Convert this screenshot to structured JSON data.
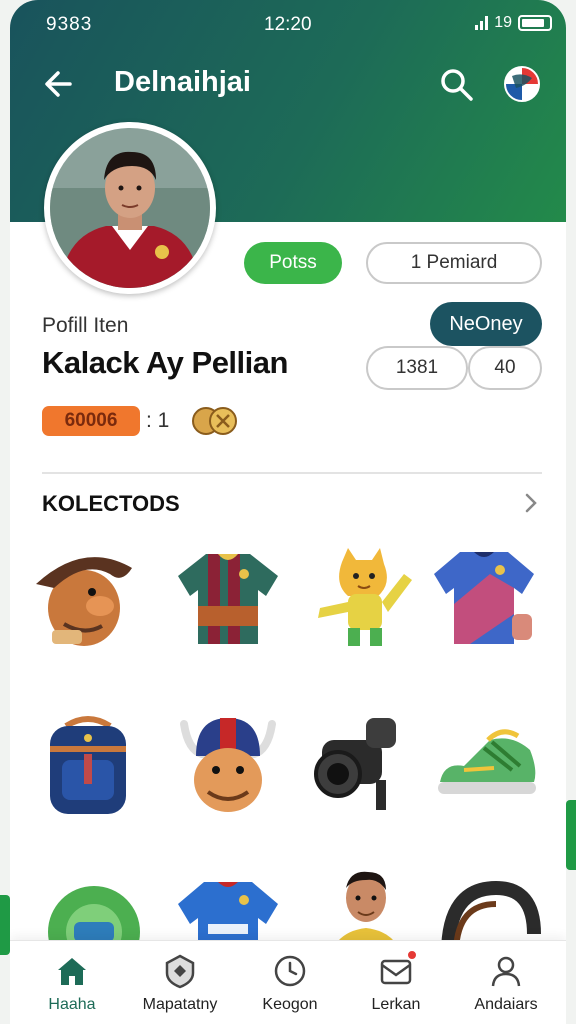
{
  "status_bar": {
    "left": "9383",
    "time": "12:20",
    "right": "19"
  },
  "header": {
    "title": "Delnaihjai",
    "back_icon": "arrow-left-icon",
    "search_icon": "search-icon",
    "globe_icon": "globe-icon"
  },
  "profile": {
    "subtitle": "Pofill Iten",
    "name": "Kalack Ay Pellian",
    "posts_label": "Potss",
    "premiard_label": "1 Pemiard",
    "money_label": "NeOney",
    "stat_a": "1381",
    "stat_b": "40",
    "level_badge": "60006",
    "level_suffix": ": 1"
  },
  "collections": {
    "title": "KOLECTODS",
    "items": [
      "pirate-hat-icon",
      "jersey-red-icon",
      "mascot-cat-icon",
      "jersey-blue-icon",
      "backpack-icon",
      "viking-mascot-icon",
      "camera-icon",
      "sneaker-icon",
      "tape-measure-icon",
      "jersey-sponsor-icon",
      "player-figure-icon",
      "headphones-icon"
    ]
  },
  "bottom_nav": [
    {
      "label": "Haaha",
      "icon": "home-icon"
    },
    {
      "label": "Mapatatny",
      "icon": "shield-icon"
    },
    {
      "label": "Keogon",
      "icon": "clock-icon"
    },
    {
      "label": "Lerkan",
      "icon": "mail-icon"
    },
    {
      "label": "Andaiars",
      "icon": "person-icon"
    }
  ],
  "colors": {
    "header_start": "#19535c",
    "header_end": "#238a4a",
    "posts": "#3bb54a",
    "money": "#1c5361",
    "level": "#f0772d"
  }
}
